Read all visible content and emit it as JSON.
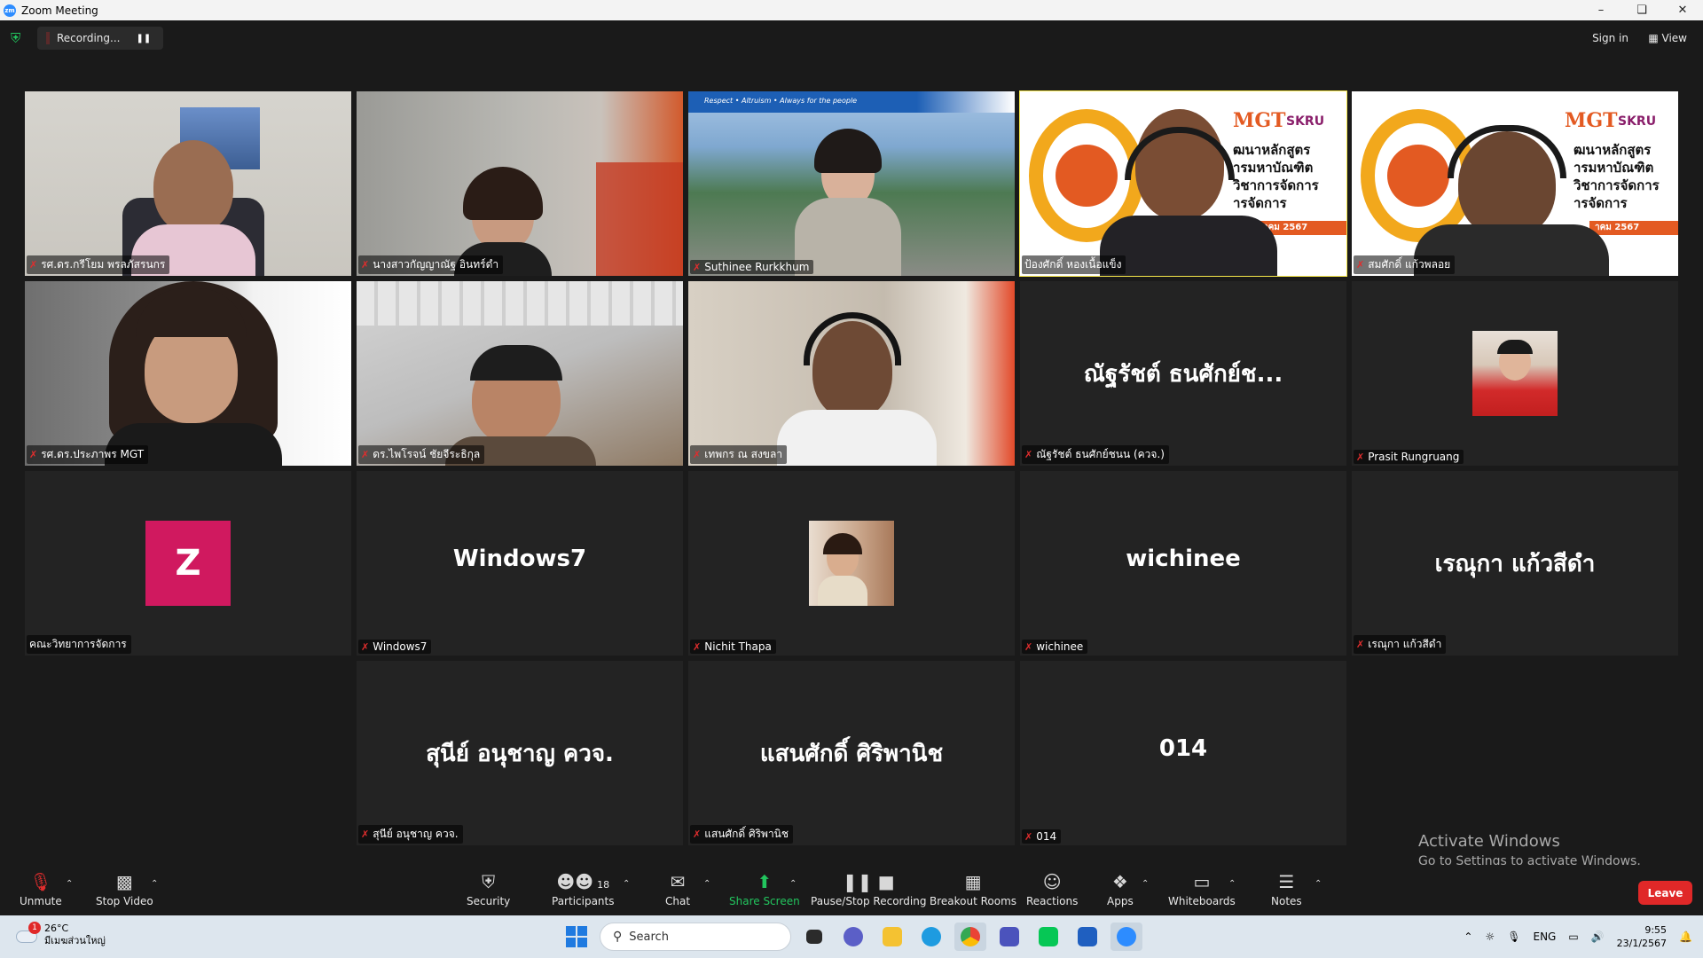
{
  "window": {
    "title": "Zoom Meeting",
    "app_icon": "zm"
  },
  "topbar": {
    "recording_label": "Recording...",
    "signin_label": "Sign in",
    "view_label": "View"
  },
  "participants_grid": [
    {
      "name": "รศ.ดร.กรีโยม พรลภัสรนกร",
      "video": true,
      "active": false
    },
    {
      "name": "นางสาวกัญญาณัฐ อินทร์ดำ",
      "video": true,
      "active": false
    },
    {
      "name": "Suthinee Rurkkhum",
      "video": true,
      "active": false,
      "banner_text": "Respect • Altruism • Always for the people"
    },
    {
      "name": "ป้องศักดิ์ หองเนื้อแข็ง",
      "video": true,
      "active": true
    },
    {
      "name": "สมศักดิ์ แก้วพลอย",
      "video": true,
      "active": false
    },
    {
      "name": "รศ.ดร.ประภาพร MGT",
      "video": true,
      "active": false
    },
    {
      "name": "ดร.ไพโรจน์ ชัยจีระธิกุล",
      "video": true,
      "active": false
    },
    {
      "name": "เทพกร ณ สงขลา",
      "video": true,
      "active": false
    },
    {
      "name": "ณัฐรัชต์ ธนศักย์ชนน (ควจ.)",
      "display_name": "ณัฐรัชต์ ธนศักย์ช...",
      "video": false
    },
    {
      "name": "Prasit Rungruang",
      "video": false,
      "avatar": "photo"
    },
    {
      "name": "คณะวิทยาการจัดการ",
      "video": false,
      "avatar_letter": "Z"
    },
    {
      "name": "Windows7",
      "display_name": "Windows7",
      "video": false
    },
    {
      "name": "Nichit Thapa",
      "video": false,
      "avatar": "photo"
    },
    {
      "name": "wichinee",
      "display_name": "wichinee",
      "video": false
    },
    {
      "name": "เรณุกา แก้วสีดำ",
      "display_name": "เรณุกา แก้วสีดำ",
      "video": false
    },
    {
      "name": "สุนีย์ อนุชาญ ควจ.",
      "display_name": "สุนีย์ อนุชาญ ควจ.",
      "video": false
    },
    {
      "name": "แสนศักดิ์ ศิริพานิช",
      "display_name": "แสนศักดิ์ ศิริพานิช",
      "video": false
    },
    {
      "name": "014",
      "display_name": "014",
      "video": false
    }
  ],
  "slide_text": {
    "logo": "MGT",
    "logo2": "SKRU",
    "line1": "ฒนาหลักสูตร",
    "line2": "ารมหาบัณฑิต",
    "line3": "วิชาการจัดการ",
    "line4": "ารจัดการ",
    "date": "าคม 2567"
  },
  "toolbar": {
    "unmute": "Unmute",
    "stop_video": "Stop Video",
    "security": "Security",
    "participants": "Participants",
    "participants_count": "18",
    "chat": "Chat",
    "share_screen": "Share Screen",
    "recording": "Pause/Stop Recording",
    "breakout": "Breakout Rooms",
    "reactions": "Reactions",
    "apps": "Apps",
    "whiteboards": "Whiteboards",
    "notes": "Notes",
    "leave": "Leave"
  },
  "activate_windows": {
    "line1": "Activate Windows",
    "line2": "Go to Settings to activate Windows."
  },
  "taskbar": {
    "weather_temp": "26°C",
    "weather_desc": "มีเมฆส่วนใหญ่",
    "weather_badge": "1",
    "search_placeholder": "Search",
    "lang": "ENG",
    "time": "9:55",
    "date": "23/1/2567"
  },
  "colors": {
    "background": "#1a1a1a",
    "tile": "#232323",
    "active_border": "#f7e84a",
    "muted_mic": "#e02d2d",
    "share_green": "#22c55e",
    "leave_red": "#e02828",
    "avatar_z": "#d0195f",
    "zoom_blue": "#2d8cff"
  }
}
